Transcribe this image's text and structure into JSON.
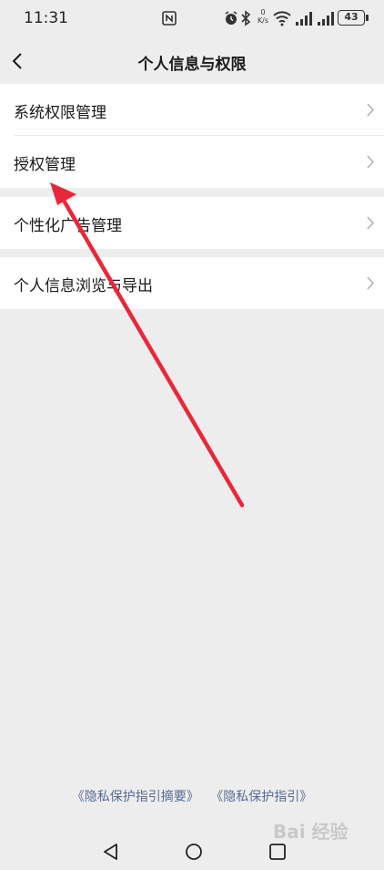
{
  "status_bar": {
    "time": "11:31",
    "speed_value": "0",
    "speed_unit": "K/s",
    "battery": "43"
  },
  "nav": {
    "title": "个人信息与权限"
  },
  "groups": [
    {
      "items": [
        {
          "label": "系统权限管理"
        },
        {
          "label": "授权管理"
        }
      ]
    },
    {
      "items": [
        {
          "label": "个性化广告管理"
        }
      ]
    },
    {
      "items": [
        {
          "label": "个人信息浏览与导出"
        }
      ]
    }
  ],
  "footer": {
    "link_summary": "《隐私保护指引摘要》",
    "link_full": "《隐私保护指引》"
  },
  "watermark": {
    "text": "Bai 经验"
  },
  "colors": {
    "background": "#ededed",
    "card": "#ffffff",
    "link": "#576b95",
    "annotation_arrow": "#e8283a"
  }
}
